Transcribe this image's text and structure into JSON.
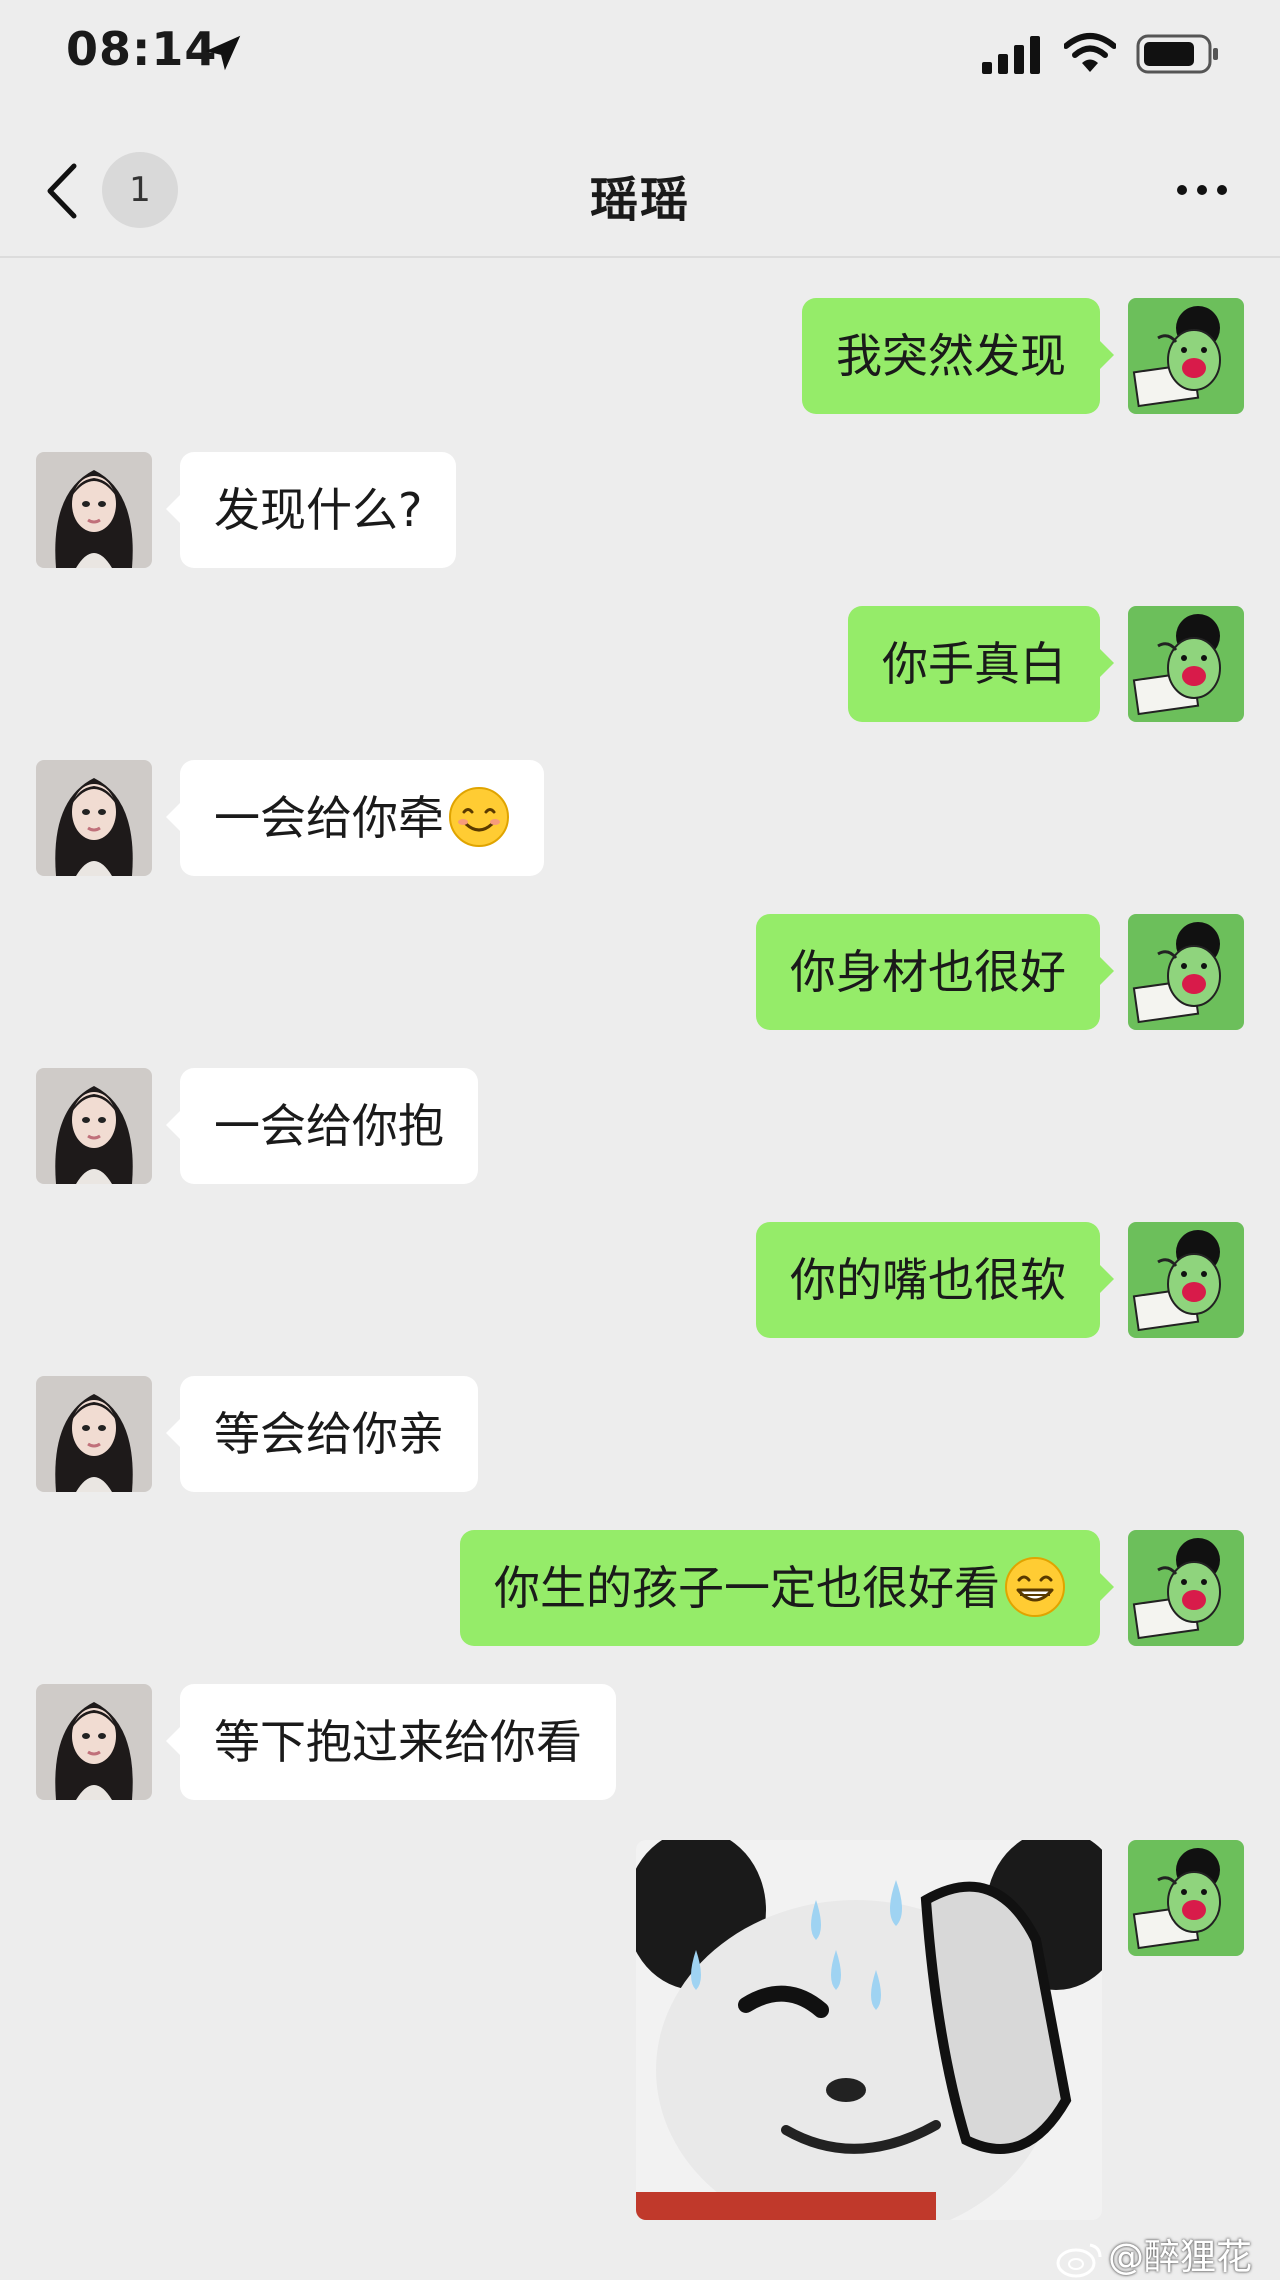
{
  "status_bar": {
    "time": "08:14"
  },
  "nav": {
    "unread_count": "1",
    "title": "瑶瑶"
  },
  "messages": [
    {
      "side": "out",
      "text": "我突然发现"
    },
    {
      "side": "in",
      "text": "发现什么?"
    },
    {
      "side": "out",
      "text": "你手真白"
    },
    {
      "side": "in",
      "text": "一会给你牵",
      "emoji": "smile-emoji-icon"
    },
    {
      "side": "out",
      "text": "你身材也很好"
    },
    {
      "side": "in",
      "text": "一会给你抱"
    },
    {
      "side": "out",
      "text": "你的嘴也很软"
    },
    {
      "side": "in",
      "text": "等会给你亲"
    },
    {
      "side": "out",
      "text": "你生的孩子一定也很好看",
      "emoji": "grin-emoji-icon"
    },
    {
      "side": "in",
      "text": "等下抱过来给你看"
    }
  ],
  "sticker": {
    "icon": "sweating-panda-sticker"
  },
  "watermark": {
    "text": "@醉狸花"
  },
  "colors": {
    "background": "#ededed",
    "outgoing_bubble": "#95ec69",
    "incoming_bubble": "#ffffff"
  }
}
